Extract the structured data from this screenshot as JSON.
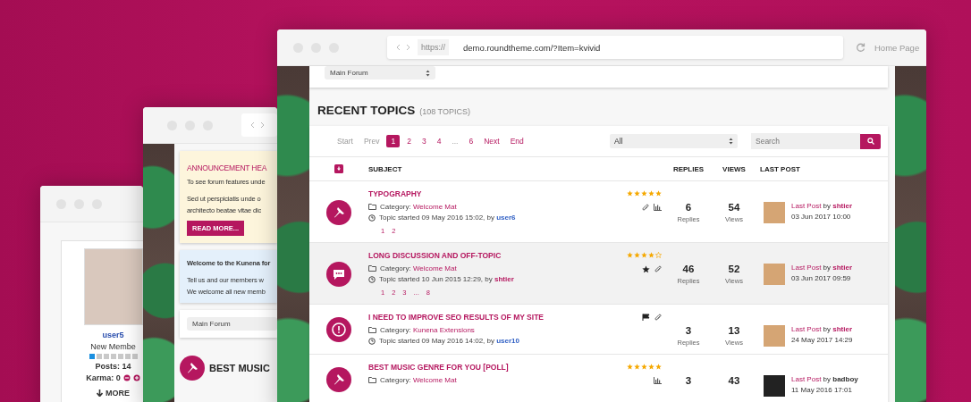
{
  "profile_window": {
    "username": "user5",
    "rank": "New Membe",
    "level": 0.14,
    "posts": "Posts: 14",
    "karma": "Karma: 0",
    "more": "MORE"
  },
  "announcement_window": {
    "announcement": {
      "title": "ANNOUNCEMENT HEA",
      "intro": "To see forum features unde",
      "body": [
        "Sed ut perspiciatis unde o",
        "architecto beatae vitae dic"
      ],
      "button": "READ MORE..."
    },
    "welcome": {
      "title": "Welcome to the Kunena for",
      "body": [
        "Tell us and our members w",
        "We welcome all new memb"
      ]
    },
    "forum_select": "Main Forum",
    "section_title": "BEST MUSIC"
  },
  "forum_window": {
    "url_scheme": "https://",
    "url": "demo.roundtheme.com/?Item=kvivid",
    "home_link": "Home Page",
    "forum_select": "Main Forum",
    "heading": "RECENT TOPICS",
    "topic_count": "(108 TOPICS)",
    "pagination": [
      {
        "label": "Start",
        "selected": false,
        "disabled": true
      },
      {
        "label": "Prev",
        "selected": false,
        "disabled": true
      },
      {
        "label": "1",
        "selected": true,
        "disabled": false
      },
      {
        "label": "2",
        "selected": false,
        "disabled": false
      },
      {
        "label": "3",
        "selected": false,
        "disabled": false
      },
      {
        "label": "4",
        "selected": false,
        "disabled": false
      },
      {
        "label": "...",
        "selected": false,
        "disabled": true
      },
      {
        "label": "6",
        "selected": false,
        "disabled": false
      },
      {
        "label": "Next",
        "selected": false,
        "disabled": false
      },
      {
        "label": "End",
        "selected": false,
        "disabled": false
      }
    ],
    "filter": "All",
    "search": {
      "placeholder": "Search"
    },
    "columns": [
      "SUBJECT",
      "REPLIES",
      "VIEWS",
      "LAST POST"
    ],
    "topics": [
      {
        "kind": "pinned",
        "selected": false,
        "title": "TYPOGRAPHY",
        "category_label": "Category:",
        "category": "Welcome Mat",
        "started": "Topic started 09 May 2016 15:02, by",
        "author": {
          "name": "user6",
          "color": "#2f5fc4"
        },
        "pages": [
          "1",
          "2"
        ],
        "stars": 5,
        "markers": [
          {
            "kind": "attachment"
          },
          {
            "kind": "poll"
          }
        ],
        "replies": "6",
        "replies_label": "Replies",
        "views": "54",
        "views_label": "Views",
        "last_post_label": "Last Post",
        "last_by": "by",
        "last_user": {
          "name": "shtier",
          "color": "#b5175f"
        },
        "last_date": "03 Jun 2017 10:00"
      },
      {
        "kind": "discussion",
        "selected": true,
        "title": "LONG DISCUSSION AND OFF-TOPIC",
        "category_label": "Category:",
        "category": "Welcome Mat",
        "started": "Topic started 10 Jun 2015 12:29, by",
        "author": {
          "name": "shtier",
          "color": "#b5175f"
        },
        "pages": [
          "1",
          "2",
          "3",
          "...",
          "8"
        ],
        "stars": 4,
        "markers": [
          {
            "kind": "star"
          },
          {
            "kind": "attachment"
          }
        ],
        "replies": "46",
        "replies_label": "Replies",
        "views": "52",
        "views_label": "Views",
        "last_post_label": "Last Post",
        "last_by": "by",
        "last_user": {
          "name": "shtier",
          "color": "#b5175f"
        },
        "last_date": "03 Jun 2017 09:59"
      },
      {
        "kind": "alert",
        "selected": false,
        "title": "I NEED TO IMPROVE SEO RESULTS OF MY SITE",
        "category_label": "Category:",
        "category": "Kunena Extensions",
        "started": "Topic started 09 May 2016 14:02, by",
        "author": {
          "name": "user10",
          "color": "#2f5fc4"
        },
        "markers": [
          {
            "kind": "flag"
          },
          {
            "kind": "attachment"
          }
        ],
        "replies": "3",
        "replies_label": "Replies",
        "views": "13",
        "views_label": "Views",
        "last_post_label": "Last Post",
        "last_by": "by",
        "last_user": {
          "name": "shtier",
          "color": "#b5175f"
        },
        "last_date": "24 May 2017 14:29"
      },
      {
        "kind": "pinned",
        "selected": false,
        "title": "BEST MUSIC GENRE FOR YOU [POLL]",
        "category_label": "Category:",
        "category": "Welcome Mat",
        "stars": 5,
        "markers": [
          {
            "kind": "poll"
          }
        ],
        "replies": "3",
        "views": "43",
        "last_post_label": "Last Post",
        "last_by": "by",
        "last_user": {
          "name": "badboy",
          "color": "#333333"
        },
        "last_date": "11 May 2016 17:01"
      }
    ]
  }
}
